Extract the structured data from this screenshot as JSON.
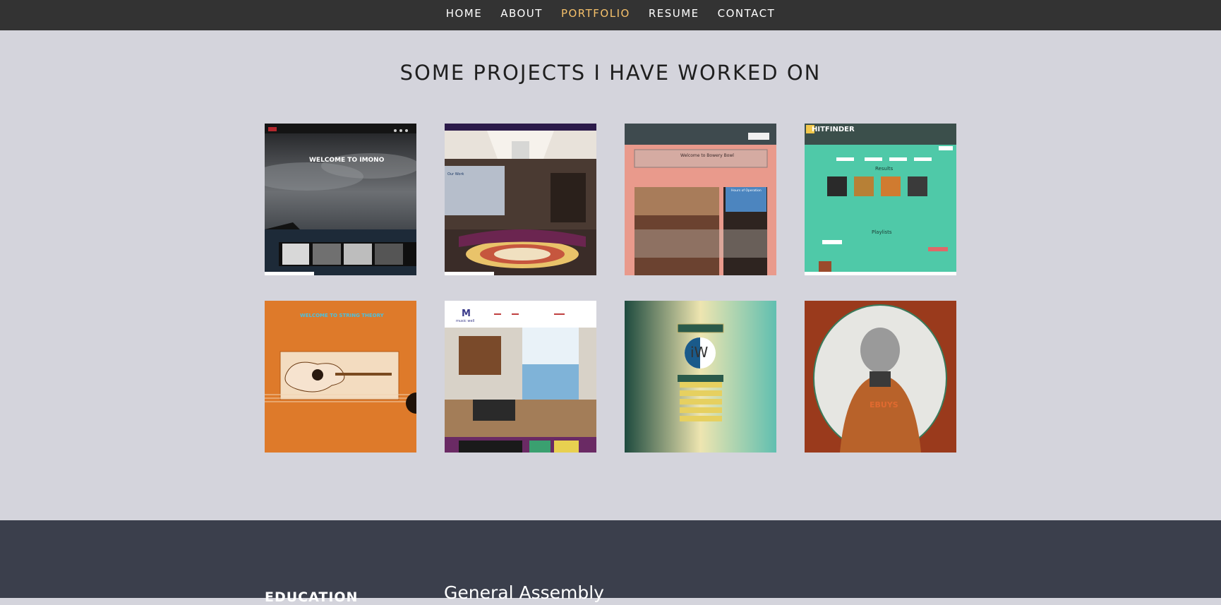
{
  "nav": {
    "items": [
      {
        "label": "HOME"
      },
      {
        "label": "ABOUT"
      },
      {
        "label": "PORTFOLIO"
      },
      {
        "label": "RESUME"
      },
      {
        "label": "CONTACT"
      }
    ],
    "active_index": 2,
    "active_color": "#f5c06a"
  },
  "portfolio": {
    "title": "SOME PROJECTS I HAVE WORKED ON",
    "projects": [
      {
        "screenshot_text": "WELCOME TO IMONO"
      },
      {
        "screenshot_text": "Our Work"
      },
      {
        "screenshot_text": "Welcome to Bowery Bowl",
        "screenshot_text_2": "Hours of Operation"
      },
      {
        "screenshot_text": "HITFINDER",
        "screenshot_text_2": "Results",
        "screenshot_text_3": "Playlists"
      },
      {
        "screenshot_text": "WELCOME TO STRING THEORY"
      },
      {
        "screenshot_text": "music well"
      },
      {
        "screenshot_text": "iW"
      },
      {
        "screenshot_text": "EBUYS"
      }
    ]
  },
  "resume": {
    "education_label": "EDUCATION",
    "school": "General Assembly"
  },
  "colors": {
    "nav_bg": "#333333",
    "page_bg": "#d4d4dc",
    "resume_bg": "#3b3f4c"
  }
}
